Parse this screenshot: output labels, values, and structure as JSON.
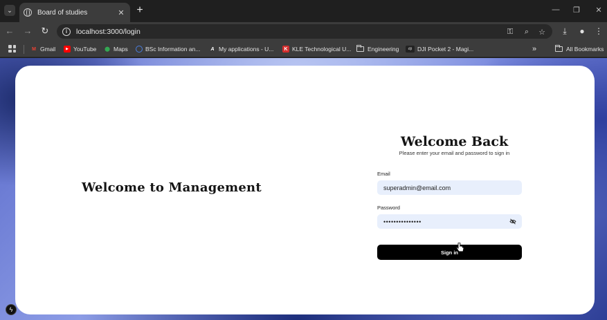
{
  "browser": {
    "tab_title": "Board of studies",
    "url": "localhost:3000/login",
    "bookmarks": [
      {
        "label": "Gmail",
        "icon": "gmail-icon",
        "color": "#ea4335"
      },
      {
        "label": "YouTube",
        "icon": "youtube-icon",
        "color": "#ff0000"
      },
      {
        "label": "Maps",
        "icon": "maps-icon",
        "color": "#34a853"
      },
      {
        "label": "BSc Information an...",
        "icon": "globe-icon",
        "color": "#4a7fe0"
      },
      {
        "label": "My applications - U...",
        "icon": "a-logo-icon",
        "color": "#ffffff"
      },
      {
        "label": "KLE Technological U...",
        "icon": "kle-logo-icon",
        "color": "#d32f2f"
      },
      {
        "label": "Engineering",
        "icon": "folder-icon",
        "color": "#d0d0d0"
      },
      {
        "label": "DJI Pocket 2 - Magi...",
        "icon": "dji-logo-icon",
        "color": "#888888"
      }
    ],
    "overflow_label": "»",
    "all_bookmarks_label": "All Bookmarks"
  },
  "page": {
    "left_heading": "Welcome to Management",
    "login": {
      "title": "Welcome Back",
      "subtitle": "Please enter your email and password to sign in",
      "email_label": "Email",
      "email_value": "superadmin@email.com",
      "password_label": "Password",
      "password_value": "•••••••••••••••",
      "submit_label": "Sign in"
    }
  },
  "colors": {
    "accent": "#000000",
    "input_bg": "#e8effc",
    "card_bg": "#ffffff"
  }
}
